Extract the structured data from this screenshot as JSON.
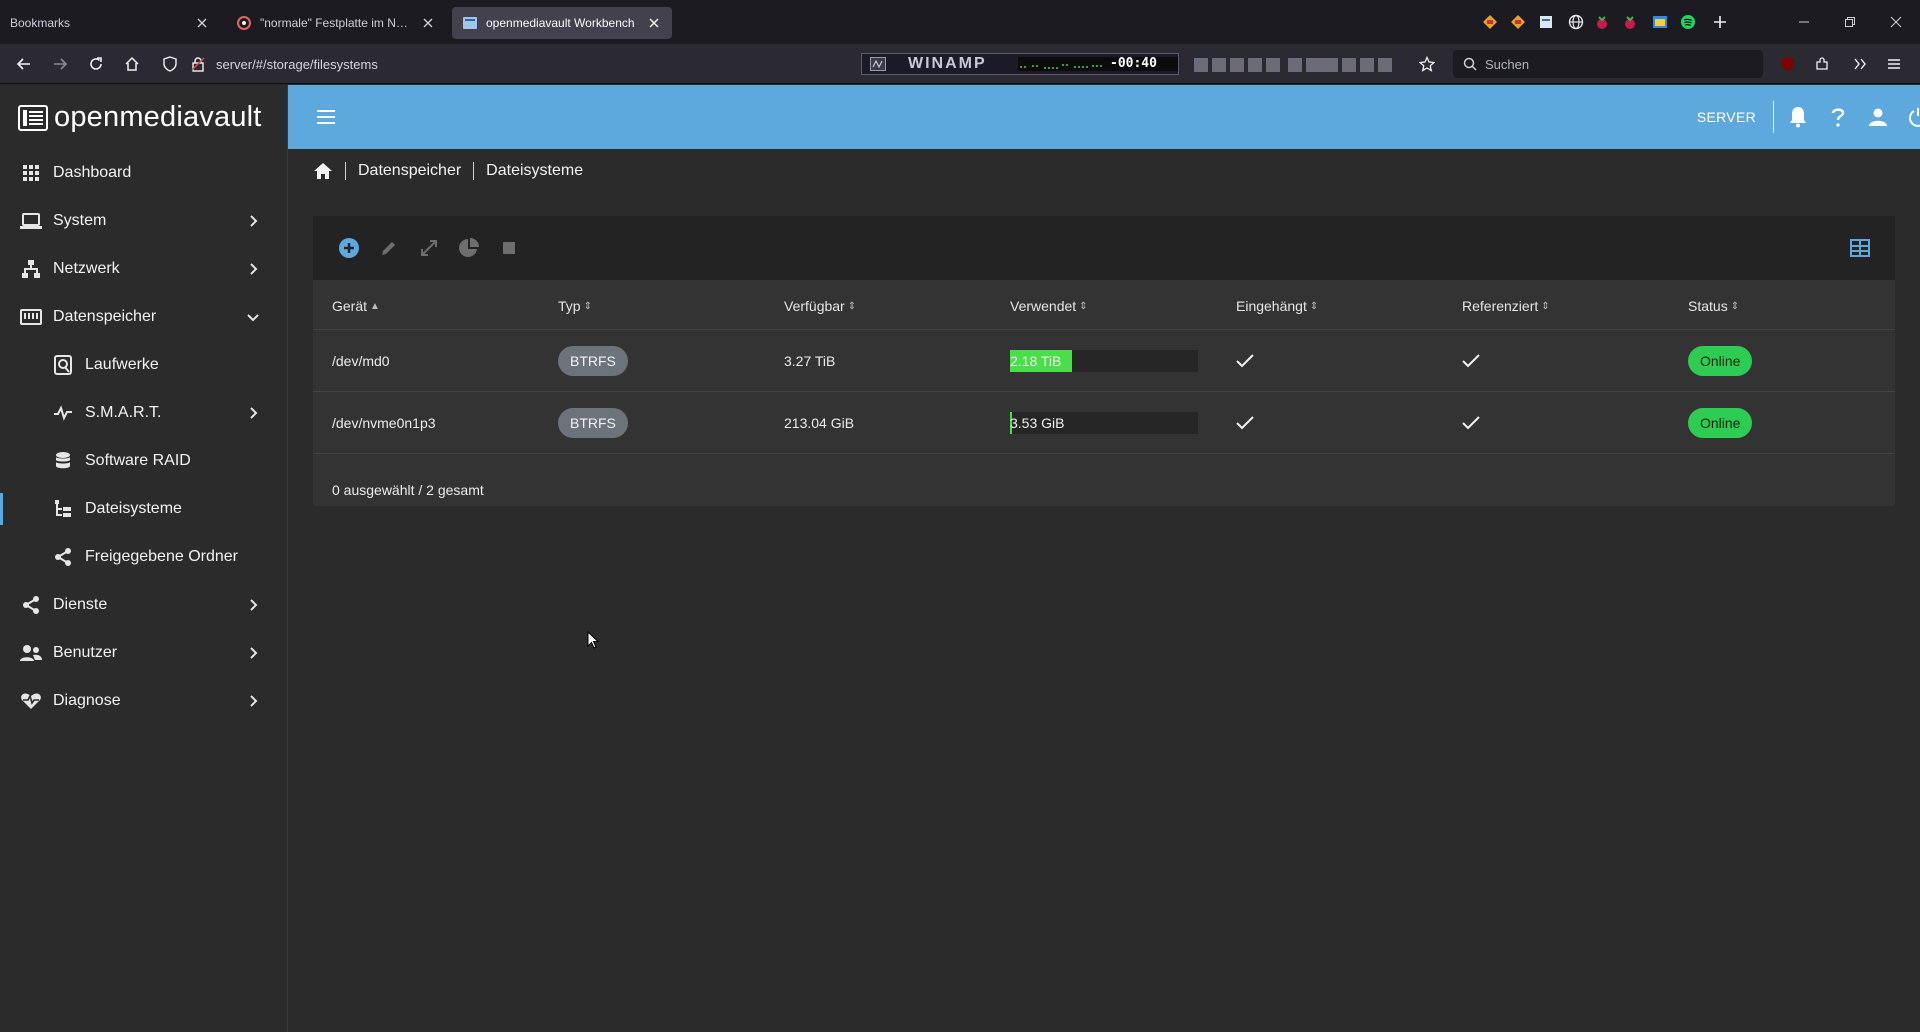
{
  "browser": {
    "tabs": [
      {
        "title": "Bookmarks",
        "active": false
      },
      {
        "title": "\"normale\" Festplatte im NAS? | ",
        "active": false
      },
      {
        "title": "openmediavault Workbench",
        "active": true
      }
    ],
    "url": "server/#/storage/filesystems",
    "search_placeholder": "Suchen",
    "winamp": {
      "title": "WINAMP",
      "time": "-00:40"
    }
  },
  "app": {
    "brand": "openmediavault",
    "server_label": "SERVER",
    "accent_color": "#5da9dd"
  },
  "sidebar": {
    "items": [
      {
        "label": "Dashboard",
        "icon": "grid-icon",
        "chevron": "none"
      },
      {
        "label": "System",
        "icon": "laptop-icon",
        "chevron": "right"
      },
      {
        "label": "Netzwerk",
        "icon": "network-icon",
        "chevron": "right"
      },
      {
        "label": "Datenspeicher",
        "icon": "storage-icon",
        "chevron": "down"
      },
      {
        "label": "Laufwerke",
        "icon": "disk-icon",
        "chevron": "none",
        "sub": true
      },
      {
        "label": "S.M.A.R.T.",
        "icon": "heartbeat-icon",
        "chevron": "right",
        "sub": true
      },
      {
        "label": "Software RAID",
        "icon": "database-icon",
        "chevron": "none",
        "sub": true
      },
      {
        "label": "Dateisysteme",
        "icon": "file-tree-icon",
        "chevron": "none",
        "sub": true,
        "active": true
      },
      {
        "label": "Freigegebene Ordner",
        "icon": "share-icon",
        "chevron": "none",
        "sub": true
      },
      {
        "label": "Dienste",
        "icon": "share-icon",
        "chevron": "right"
      },
      {
        "label": "Benutzer",
        "icon": "users-icon",
        "chevron": "right"
      },
      {
        "label": "Diagnose",
        "icon": "heart-pulse-icon",
        "chevron": "right"
      }
    ]
  },
  "breadcrumb": {
    "items": [
      "Datenspeicher",
      "Dateisysteme"
    ]
  },
  "table": {
    "columns": [
      "Gerät",
      "Typ",
      "Verfügbar",
      "Verwendet",
      "Eingehängt",
      "Referenziert",
      "Status"
    ],
    "sorted_column": "Gerät",
    "rows": [
      {
        "device": "/dev/md0",
        "type": "BTRFS",
        "available": "3.27 TiB",
        "used": "2.18 TiB",
        "used_fraction": 0.33,
        "mounted": true,
        "referenced": true,
        "status": "Online"
      },
      {
        "device": "/dev/nvme0n1p3",
        "type": "BTRFS",
        "available": "213.04 GiB",
        "used": "3.53 GiB",
        "used_fraction": 0.01,
        "mounted": true,
        "referenced": true,
        "status": "Online"
      }
    ],
    "footer": "0 ausgewählt / 2 gesamt"
  }
}
